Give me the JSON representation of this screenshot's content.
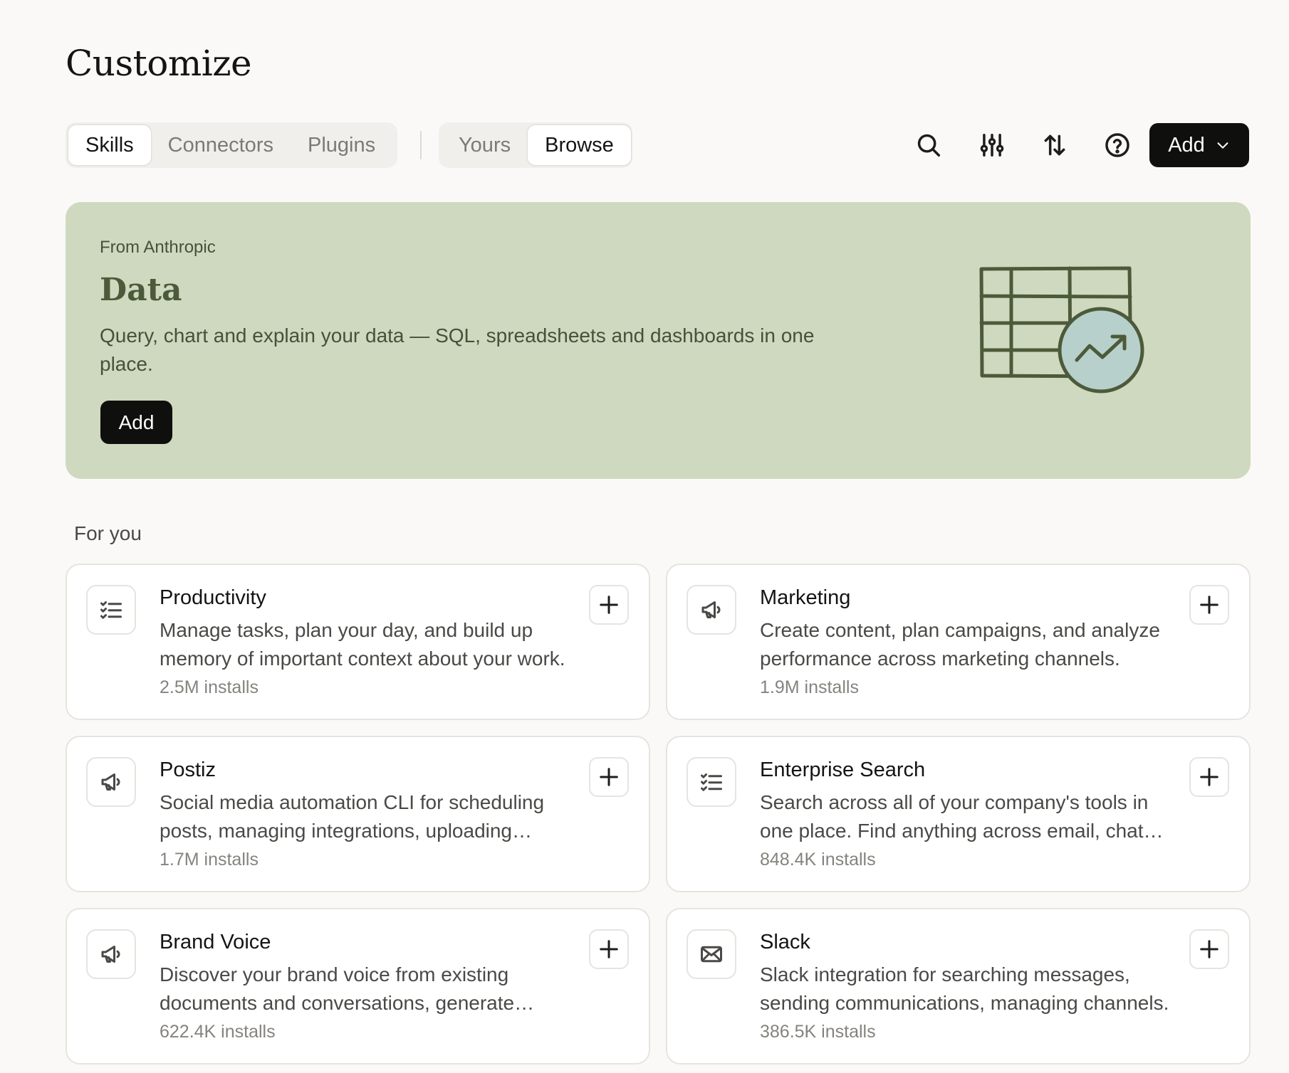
{
  "page": {
    "title": "Customize"
  },
  "tabs_left": [
    {
      "label": "Skills",
      "active": true
    },
    {
      "label": "Connectors",
      "active": false
    },
    {
      "label": "Plugins",
      "active": false
    }
  ],
  "tabs_right": [
    {
      "label": "Yours",
      "active": false
    },
    {
      "label": "Browse",
      "active": true
    }
  ],
  "toolbar": {
    "icons": [
      "search-icon",
      "filter-sliders-icon",
      "sort-icon",
      "help-icon"
    ],
    "add_label": "Add"
  },
  "banner": {
    "eyebrow": "From Anthropic",
    "title": "Data",
    "description": "Query, chart and explain your data — SQL, spreadsheets and dashboards in one place.",
    "add_label": "Add",
    "background": "#cfd9bf",
    "accent": "#4d5a3a"
  },
  "section": {
    "label": "For you"
  },
  "cards": [
    {
      "title": "Productivity",
      "description": "Manage tasks, plan your day, and build up memory of important context about your work.",
      "installs": "2.5M installs",
      "icon": "checklist-icon"
    },
    {
      "title": "Marketing",
      "description": "Create content, plan campaigns, and analyze performance across marketing channels.",
      "installs": "1.9M installs",
      "icon": "megaphone-icon"
    },
    {
      "title": "Postiz",
      "description": "Social media automation CLI for scheduling posts, managing integrations, uploading media.",
      "installs": "1.7M installs",
      "icon": "megaphone-icon"
    },
    {
      "title": "Enterprise Search",
      "description": "Search across all of your company's tools in one place. Find anything across email, chat and docs.",
      "installs": "848.4K installs",
      "icon": "checklist-icon"
    },
    {
      "title": "Brand Voice",
      "description": "Discover your brand voice from existing documents and conversations, generate guidelines.",
      "installs": "622.4K installs",
      "icon": "megaphone-icon"
    },
    {
      "title": "Slack",
      "description": "Slack integration for searching messages, sending communications, managing channels.",
      "installs": "386.5K installs",
      "icon": "envelope-icon"
    }
  ]
}
